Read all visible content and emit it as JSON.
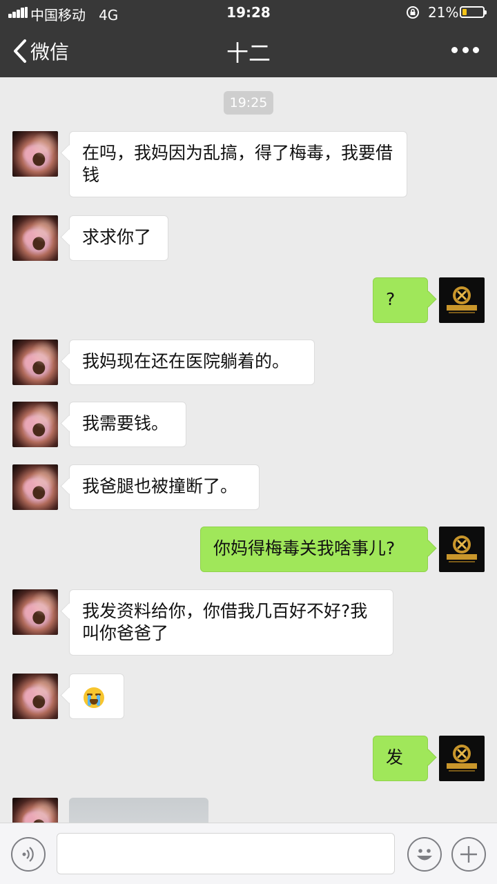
{
  "status_bar": {
    "carrier": "中国移动",
    "network": "4G",
    "time": "19:28",
    "battery_percent": "21%",
    "battery_level": 0.21,
    "lock_icon": "rotation-lock-icon"
  },
  "nav": {
    "back_label": "微信",
    "title": "十二",
    "more_icon": "more-dots-icon"
  },
  "chat": {
    "timestamp": "19:25",
    "messages": [
      {
        "side": "left",
        "text": "在吗，我妈因为乱搞，得了梅毒，我要借钱"
      },
      {
        "side": "left",
        "text": "求求你了"
      },
      {
        "side": "right",
        "text": "?"
      },
      {
        "side": "left",
        "text": "我妈现在还在医院躺着的。"
      },
      {
        "side": "left",
        "text": "我需要钱。"
      },
      {
        "side": "left",
        "text": "我爸腿也被撞断了。"
      },
      {
        "side": "right",
        "text": "你妈得梅毒关我啥事儿?"
      },
      {
        "side": "left",
        "text": "我发资料给你，你借我几百好不好?我叫你爸爸了"
      },
      {
        "side": "left",
        "emoji": "crying-face-emoji"
      },
      {
        "side": "right",
        "text": "发"
      },
      {
        "side": "left",
        "image": "photo-message"
      }
    ]
  },
  "colors": {
    "topbar": "#383838",
    "chat_bg": "#ebebeb",
    "my_bubble": "#a0e75a",
    "their_bubble": "#ffffff"
  },
  "input_bar": {
    "voice_icon": "voice-icon",
    "emoji_icon": "emoji-icon",
    "plus_icon": "plus-icon",
    "text_value": ""
  }
}
